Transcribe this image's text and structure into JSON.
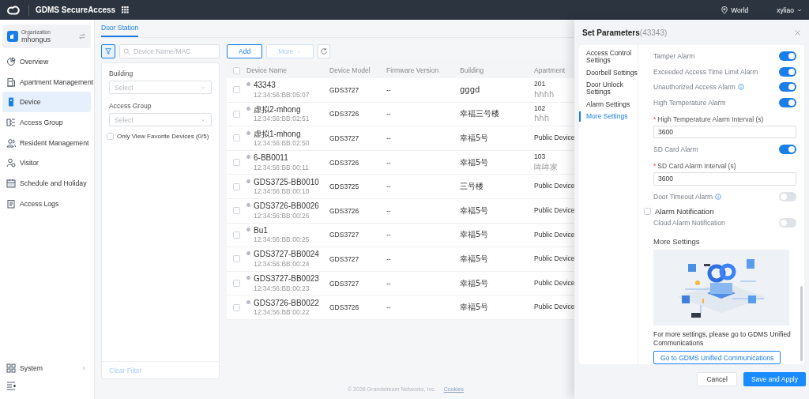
{
  "topbar": {
    "app_name": "GDMS SecureAccess",
    "region": "World",
    "user": "xyliao"
  },
  "sidebar": {
    "org_label": "Organization",
    "org_name": "mhongus",
    "items": [
      {
        "kind": "overview",
        "label": "Overview",
        "selected": false
      },
      {
        "kind": "apartment",
        "label": "Apartment Management",
        "selected": false
      },
      {
        "kind": "device",
        "label": "Device",
        "selected": true
      },
      {
        "kind": "group",
        "label": "Access Group",
        "selected": false
      },
      {
        "kind": "resident",
        "label": "Resident Management",
        "selected": false
      },
      {
        "kind": "visitor",
        "label": "Visitor",
        "selected": false
      },
      {
        "kind": "schedule",
        "label": "Schedule and Holiday",
        "selected": false
      },
      {
        "kind": "logs",
        "label": "Access Logs",
        "selected": false
      }
    ],
    "bottom_item": {
      "label": "System"
    }
  },
  "tabs": [
    {
      "label": "Door Station",
      "selected": true
    }
  ],
  "filter": {
    "search_placeholder": "Device Name/MAC",
    "fields": [
      {
        "label": "Building",
        "placeholder": "Select"
      },
      {
        "label": "Access Group",
        "placeholder": "Select"
      }
    ],
    "favorite": {
      "label": "Only View Favorite Devices (0/5)",
      "checked": false
    },
    "clear": "Clear Filter"
  },
  "toolbar": {
    "add": "Add",
    "more": "More",
    "more_disabled": true
  },
  "table": {
    "select_all_checked": false,
    "columns": [
      "Device Name",
      "Device Model",
      "Firmware Version",
      "Building",
      "Apartment"
    ],
    "rows": [
      {
        "checked": false,
        "online": false,
        "name": "43343",
        "mac": "12:34:56:BB:05:07",
        "model": "GDS3727",
        "firmware": "--",
        "building": "gggd",
        "apartment": "201",
        "apartment_sub": "hhhh"
      },
      {
        "checked": false,
        "online": false,
        "name": "虚拟2-mhong",
        "mac": "12:34:56:BB:02:51",
        "model": "GDS3726",
        "firmware": "--",
        "building": "幸福三号楼",
        "apartment": "102",
        "apartment_sub": "hhh"
      },
      {
        "checked": false,
        "online": false,
        "name": "虚拟1-mhong",
        "mac": "12:34:56:BB:02:50",
        "model": "GDS3727",
        "firmware": "--",
        "building": "幸福5号",
        "apartment": "Public Device"
      },
      {
        "checked": false,
        "online": false,
        "name": "6-BB0011",
        "mac": "12:34:56:BB:00:11",
        "model": "GDS3726",
        "firmware": "--",
        "building": "幸福5号",
        "apartment": "103",
        "apartment_sub": "哞哞家"
      },
      {
        "checked": false,
        "online": false,
        "name": "GDS3725-BB0010",
        "mac": "12:34:56:BB:00:10",
        "model": "GDS3725",
        "firmware": "--",
        "building": "三号楼",
        "apartment": "Public Device"
      },
      {
        "checked": false,
        "online": false,
        "name": "GDS3726-BB0026",
        "mac": "12:34:56:BB:00:26",
        "model": "GDS3726",
        "firmware": "--",
        "building": "幸福5号",
        "apartment": "Public Device"
      },
      {
        "checked": false,
        "online": false,
        "name": "Bu1",
        "mac": "12:34:56:BB:00:25",
        "model": "GDS3727",
        "firmware": "--",
        "building": "幸福5号",
        "apartment": "Public Device"
      },
      {
        "checked": false,
        "online": false,
        "name": "GDS3727-BB0024",
        "mac": "12:34:56:BB:00:24",
        "model": "GDS3727",
        "firmware": "--",
        "building": "幸福5号",
        "apartment": "Public Device"
      },
      {
        "checked": false,
        "online": false,
        "name": "GDS3727-BB0023",
        "mac": "12:34:56:BB:00:23",
        "model": "GDS3727",
        "firmware": "--",
        "building": "幸福5号",
        "apartment": "Public Device"
      },
      {
        "checked": false,
        "online": false,
        "name": "GDS3726-BB0022",
        "mac": "12:34:56:BB:00:22",
        "model": "GDS3726",
        "firmware": "--",
        "building": "幸福5号",
        "apartment": "Public Device"
      }
    ]
  },
  "footer": {
    "copyright": "© 2026 Grandstream Networks, Inc.",
    "link": "Cookies"
  },
  "drawer": {
    "title": "Set Parameters",
    "subtitle": "(43343)",
    "nav": [
      {
        "label": "Access Control Settings",
        "selected": false
      },
      {
        "label": "Doorbell Settings",
        "selected": false
      },
      {
        "label": "Door Unlock Settings",
        "selected": false
      },
      {
        "label": "Alarm Settings",
        "selected": false
      },
      {
        "label": "More Settings",
        "selected": true
      }
    ],
    "settings": [
      {
        "kind": "toggle",
        "label": "Tamper Alarm",
        "on": true,
        "info": false
      },
      {
        "kind": "toggle",
        "label": "Exceeded Access Time Limit Alarm",
        "on": true,
        "info": false
      },
      {
        "kind": "toggle",
        "label": "Unauthorized Access Alarm",
        "on": true,
        "info": true
      },
      {
        "kind": "toggle",
        "label": "High Temperature Alarm",
        "on": true,
        "info": false
      },
      {
        "kind": "input",
        "label": "High Temperature Alarm Interval (s)",
        "required_mark": "*",
        "value": "3600"
      },
      {
        "kind": "toggle",
        "label": "SD Card Alarm",
        "on": true,
        "info": false
      },
      {
        "kind": "input",
        "label": "SD Card Alarm Interval (s)",
        "required_mark": "*",
        "value": "3600"
      },
      {
        "kind": "toggle",
        "label": "Door Timeout Alarm",
        "on": false,
        "info": true
      },
      {
        "kind": "check",
        "label": "Alarm Notification",
        "checked": false
      },
      {
        "kind": "toggle",
        "label": "Cloud Alarm Notification",
        "on": false,
        "info": false
      },
      {
        "kind": "heading",
        "label": "More Settings"
      },
      {
        "kind": "picture"
      },
      {
        "kind": "text",
        "label": "For more settings, please go to GDMS Unified Communications"
      },
      {
        "kind": "button",
        "label": "Go to GDMS Unified Communications"
      }
    ],
    "buttons": {
      "cancel": "Cancel",
      "apply": "Save and Apply"
    }
  }
}
